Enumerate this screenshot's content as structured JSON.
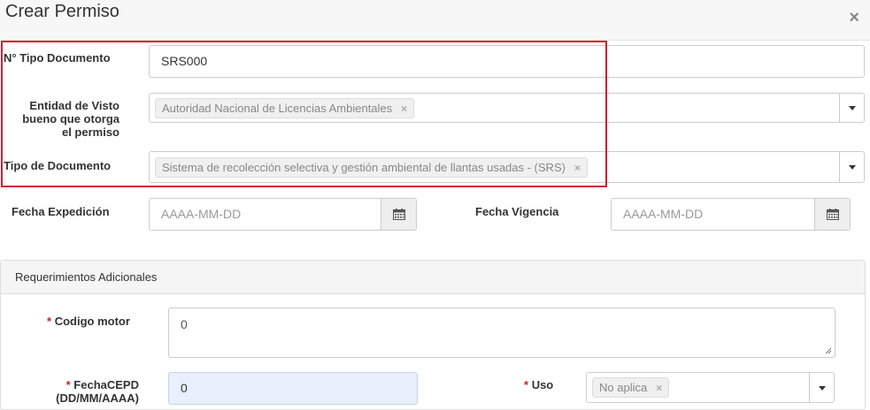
{
  "modal": {
    "title": "Crear Permiso",
    "close_symbol": "×"
  },
  "form": {
    "tipo_documento_numero": {
      "label": "N° Tipo Documento",
      "value": "SRS000"
    },
    "entidad": {
      "label_lines": [
        "Entidad de Visto",
        "bueno que otorga",
        "el permiso"
      ],
      "selected_tag": "Autoridad Nacional de Licencias Ambientales"
    },
    "tipo_documento": {
      "label": "Tipo de Documento",
      "selected_tag": "Sistema de recolección selectiva y gestión ambiental de llantas usadas - (SRS)"
    },
    "fecha_expedicion": {
      "label": "Fecha Expedición",
      "placeholder": "AAAA-MM-DD"
    },
    "fecha_vigencia": {
      "label": "Fecha Vigencia",
      "placeholder": "AAAA-MM-DD"
    }
  },
  "additional": {
    "title": "Requerimientos Adicionales",
    "required_mark": "*",
    "codigo_motor": {
      "label": "Codigo motor",
      "value": "0"
    },
    "fecha_cepd": {
      "label_lines": [
        "FechaCEPD",
        "(DD/MM/AAAA)"
      ],
      "value": "0"
    },
    "uso": {
      "label": "Uso",
      "selected_tag": "No aplica"
    }
  },
  "tag_remove_symbol": "×",
  "colors": {
    "highlight": "#d0202e",
    "required": "#d0202e",
    "header_bg": "#f7f7f7",
    "focused_bg": "#e8f0fe"
  }
}
